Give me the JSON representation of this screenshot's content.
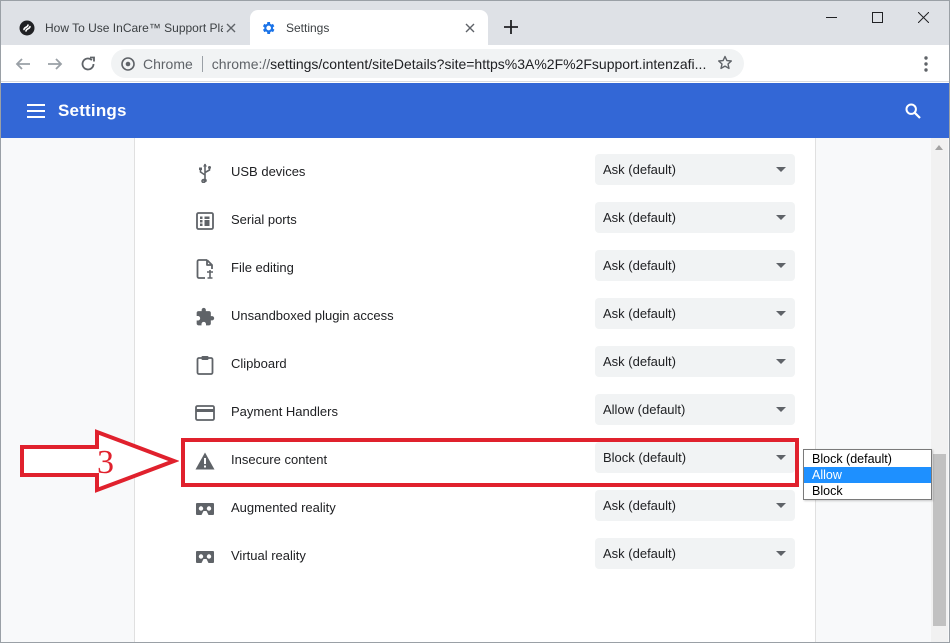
{
  "browser": {
    "tabs": [
      {
        "title": "How To Use InCare™ Support Pla",
        "active": false
      },
      {
        "title": "Settings",
        "active": true
      }
    ],
    "omnibox": {
      "scheme_label": "Chrome",
      "url_prefix": "chrome://",
      "url_rest": "settings/content/siteDetails?site=https%3A%2F%2Fsupport.intenzafi..."
    }
  },
  "header": {
    "title": "Settings"
  },
  "permissions": [
    {
      "label": "USB devices",
      "value": "Ask (default)",
      "icon": "usb-icon"
    },
    {
      "label": "Serial ports",
      "value": "Ask (default)",
      "icon": "serial-port-icon"
    },
    {
      "label": "File editing",
      "value": "Ask (default)",
      "icon": "file-edit-icon"
    },
    {
      "label": "Unsandboxed plugin access",
      "value": "Ask (default)",
      "icon": "puzzle-icon"
    },
    {
      "label": "Clipboard",
      "value": "Ask (default)",
      "icon": "clipboard-icon"
    },
    {
      "label": "Payment Handlers",
      "value": "Allow (default)",
      "icon": "credit-card-icon"
    },
    {
      "label": "Insecure content",
      "value": "Block (default)",
      "icon": "warning-icon"
    },
    {
      "label": "Augmented reality",
      "value": "Ask (default)",
      "icon": "vr-headset-icon"
    },
    {
      "label": "Virtual reality",
      "value": "Ask (default)",
      "icon": "vr-headset-icon"
    }
  ],
  "dropdown": {
    "options": [
      "Block (default)",
      "Allow",
      "Block"
    ],
    "selected": "Allow"
  },
  "annotation": {
    "step": "3",
    "color": "#e0212d"
  },
  "colors": {
    "header_blue": "#3367d6",
    "dropdown_highlight": "#1e90ff"
  }
}
